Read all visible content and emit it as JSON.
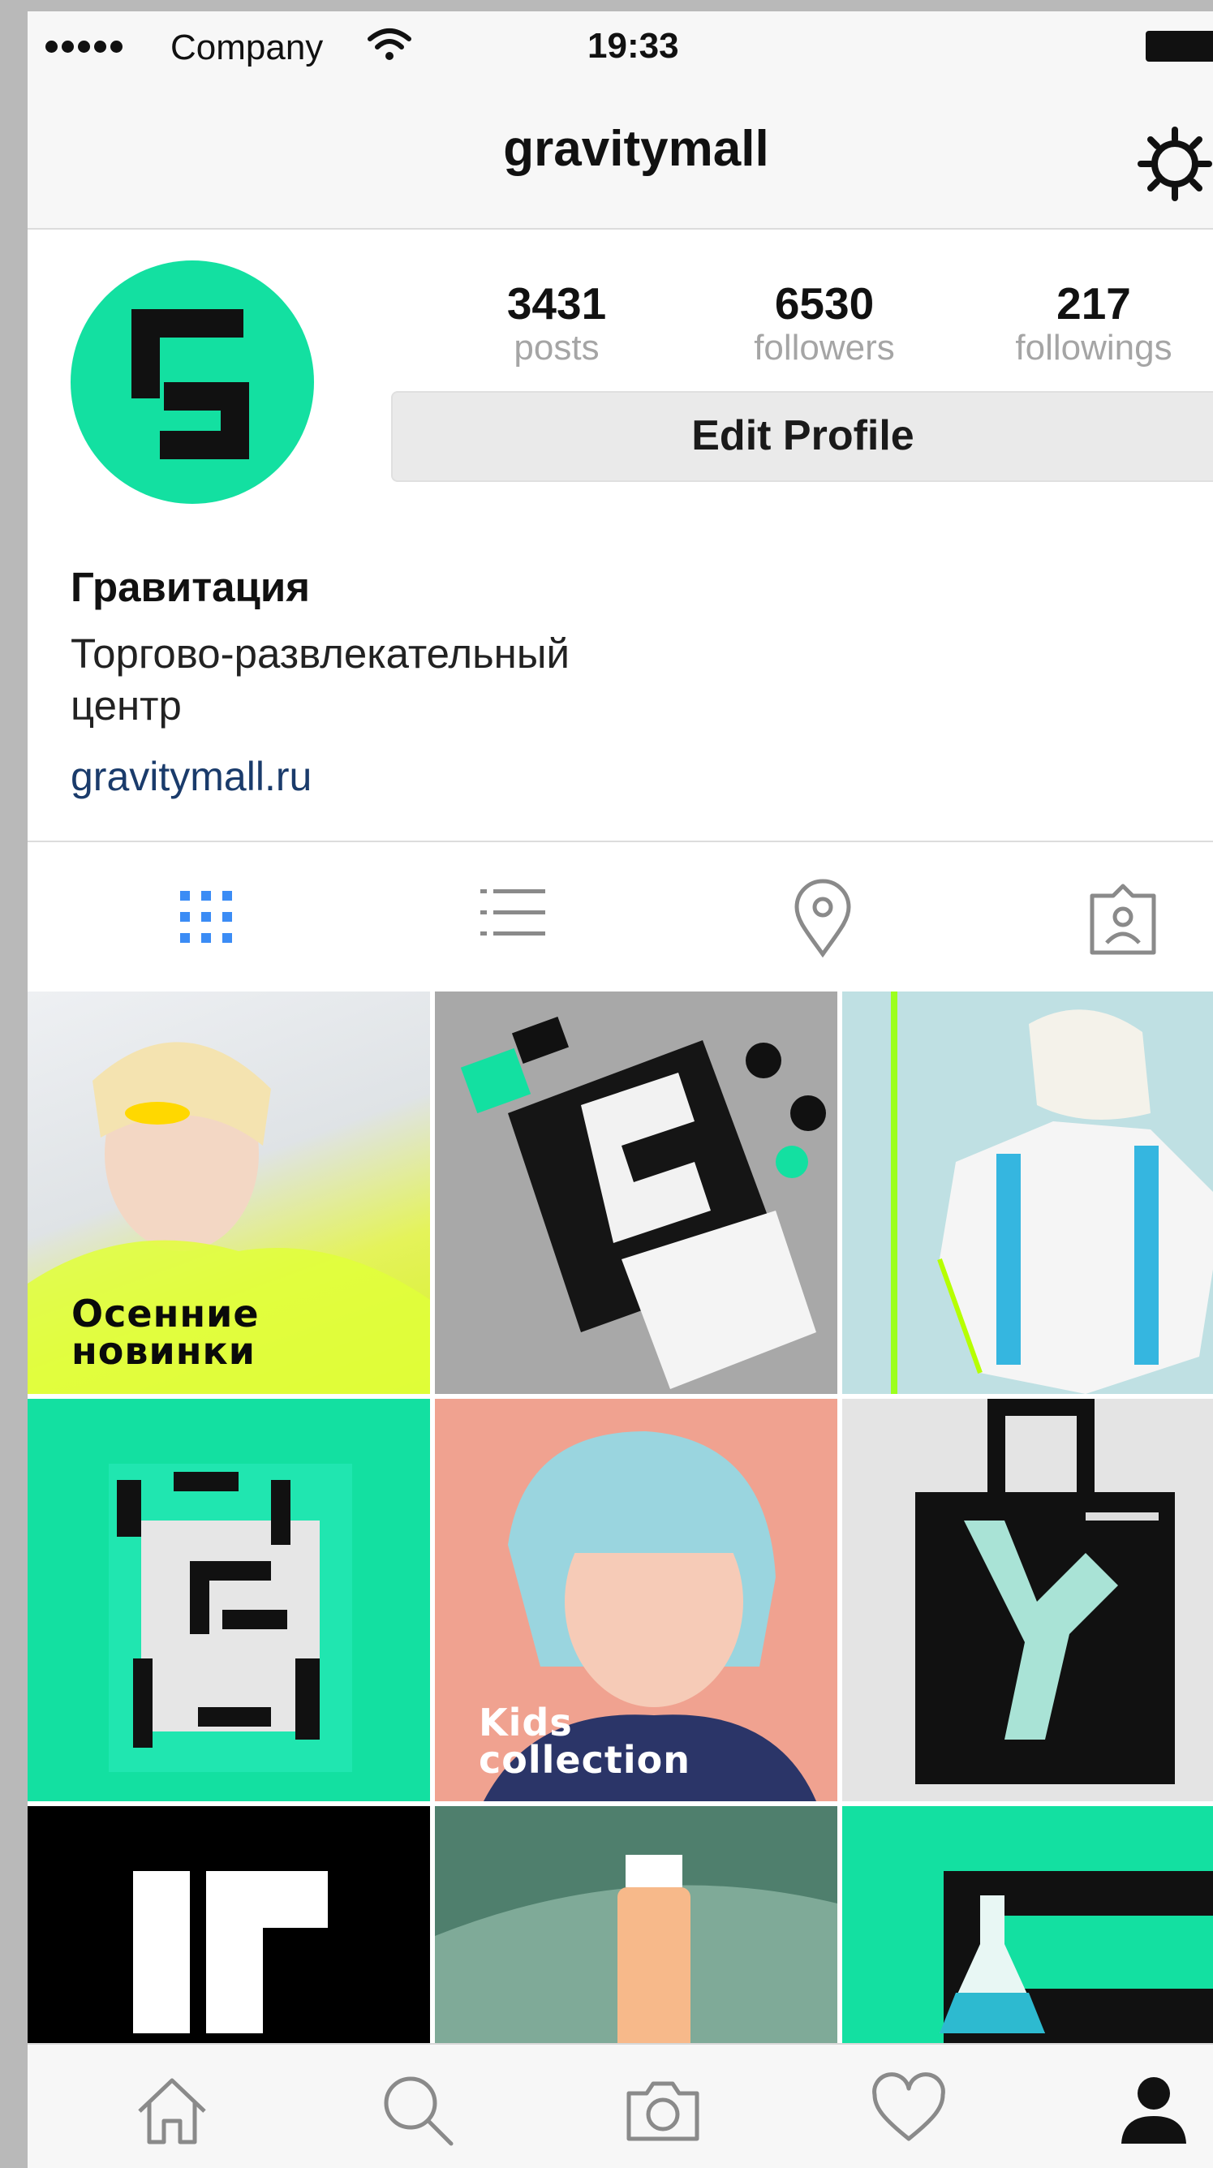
{
  "status_bar": {
    "carrier": "Company",
    "time": "19:33"
  },
  "nav": {
    "title": "gravitymall"
  },
  "profile": {
    "stats": [
      {
        "value": "3431",
        "label": "posts"
      },
      {
        "value": "6530",
        "label": "followers"
      },
      {
        "value": "217",
        "label": "followings"
      }
    ],
    "edit_label": "Edit Profile",
    "name": "Гравитация",
    "description": "Торгово-развлекательный центр",
    "website": "gravitymall.ru"
  },
  "view_tabs": [
    {
      "icon": "grid-icon",
      "active": true
    },
    {
      "icon": "list-icon",
      "active": false
    },
    {
      "icon": "location-pin-icon",
      "active": false
    },
    {
      "icon": "tagged-photos-icon",
      "active": false
    }
  ],
  "posts": [
    {
      "caption_line1": "Осенние",
      "caption_line2": "новинки"
    },
    {
      "caption_line1": "",
      "caption_line2": ""
    },
    {
      "caption_line1": "",
      "caption_line2": ""
    },
    {
      "caption_line1": "",
      "caption_line2": ""
    },
    {
      "caption_line1": "Kids",
      "caption_line2": "collection"
    },
    {
      "caption_line1": "",
      "caption_line2": ""
    },
    {
      "caption_line1": "",
      "caption_line2": ""
    },
    {
      "caption_line1": "",
      "caption_line2": ""
    },
    {
      "caption_line1": "",
      "caption_line2": ""
    }
  ],
  "tab_bar": [
    {
      "icon": "home-icon"
    },
    {
      "icon": "search-icon"
    },
    {
      "icon": "camera-icon"
    },
    {
      "icon": "heart-icon"
    },
    {
      "icon": "profile-icon",
      "active": true
    }
  ],
  "colors": {
    "accent": "#13e0a1",
    "link": "#1a3b6b",
    "active_tab": "#3b8cf5"
  }
}
